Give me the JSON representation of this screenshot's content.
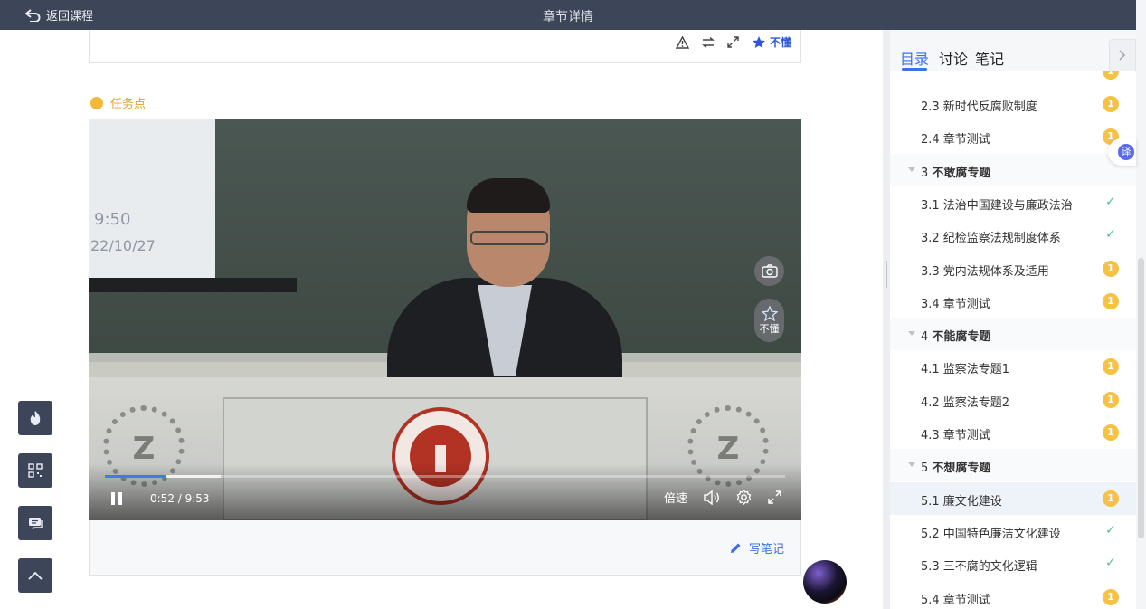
{
  "header": {
    "back_label": "返回课程",
    "title": "章节详情"
  },
  "card_tools": {
    "dont_understand": "不懂"
  },
  "task_point": "任务点",
  "video": {
    "screen_time": "9:50",
    "screen_date": "22/10/27",
    "dont_understand": "不懂",
    "current_time": "0:52 / 9:53",
    "speed_label": "倍速",
    "progress_played": 0.09,
    "progress_buffered": 0.17
  },
  "notes": {
    "write_label": "写笔记"
  },
  "right_panel": {
    "tabs": [
      "目录",
      "讨论",
      "笔记"
    ],
    "active_tab": "目录",
    "translate_label": "译",
    "items": [
      {
        "type": "section",
        "label": "2.3 新时代反腐败制度",
        "status": "1"
      },
      {
        "type": "section",
        "label": "2.4 章节测试",
        "status": "1"
      },
      {
        "type": "chapter",
        "num": "3",
        "label": "不敢腐专题"
      },
      {
        "type": "section",
        "label": "3.1 法治中国建设与廉政法治",
        "status": "done"
      },
      {
        "type": "section",
        "label": "3.2 纪检监察法规制度体系",
        "status": "done"
      },
      {
        "type": "section",
        "label": "3.3 党内法规体系及适用",
        "status": "1"
      },
      {
        "type": "section",
        "label": "3.4 章节测试",
        "status": "1"
      },
      {
        "type": "chapter",
        "num": "4",
        "label": "不能腐专题"
      },
      {
        "type": "section",
        "label": "4.1 监察法专题1",
        "status": "1"
      },
      {
        "type": "section",
        "label": "4.2 监察法专题2",
        "status": "1"
      },
      {
        "type": "section",
        "label": "4.3 章节测试",
        "status": "1"
      },
      {
        "type": "chapter",
        "num": "5",
        "label": "不想腐专题"
      },
      {
        "type": "section",
        "label": "5.1 廉文化建设",
        "status": "1",
        "current": true
      },
      {
        "type": "section",
        "label": "5.2 中国特色廉洁文化建设",
        "status": "done"
      },
      {
        "type": "section",
        "label": "5.3 三不腐的文化逻辑",
        "status": "done"
      },
      {
        "type": "section",
        "label": "5.4 章节测试",
        "status": "1"
      }
    ]
  }
}
